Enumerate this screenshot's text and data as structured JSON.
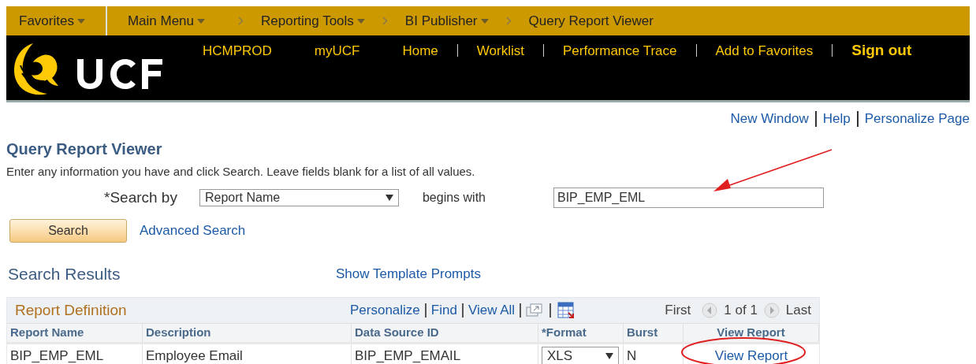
{
  "breadcrumb": [
    {
      "label": "Favorites",
      "dropdown": true
    },
    {
      "label": "Main Menu",
      "dropdown": true
    },
    {
      "label": "Reporting Tools",
      "dropdown": true
    },
    {
      "label": "BI Publisher",
      "dropdown": true
    },
    {
      "label": "Query Report Viewer",
      "dropdown": false
    }
  ],
  "header_links": [
    {
      "label": "HCMPROD",
      "emphasized": false
    },
    {
      "label": "myUCF",
      "emphasized": false
    },
    {
      "label": "Home",
      "emphasized": false
    },
    {
      "label": "Worklist",
      "emphasized": false
    },
    {
      "label": "Performance Trace",
      "emphasized": false
    },
    {
      "label": "Add to Favorites",
      "emphasized": false
    },
    {
      "label": "Sign out",
      "emphasized": true
    }
  ],
  "page_links": [
    "New Window",
    "Help",
    "Personalize Page"
  ],
  "title": "Query Report Viewer",
  "instructions": "Enter any information you have and click Search. Leave fields blank for a list of all values.",
  "search": {
    "label": "*Search by",
    "field": "Report Name",
    "operator": "begins with",
    "value": "BIP_EMP_EML",
    "button": "Search",
    "advanced_link": "Advanced Search"
  },
  "results": {
    "heading": "Search Results",
    "prompts_link": "Show Template Prompts",
    "grid": {
      "title": "Report Definition",
      "links": [
        "Personalize",
        "Find",
        "View All"
      ],
      "first": "First",
      "count": "1 of 1",
      "last": "Last",
      "columns": [
        "Report Name",
        "Description",
        "Data Source ID",
        "*Format",
        "Burst",
        "View Report"
      ],
      "rows": [
        {
          "report_name": "BIP_EMP_EML",
          "description": "Employee Email",
          "data_source_id": "BIP_EMP_EMAIL",
          "format": "XLS",
          "burst": "N",
          "view_report": "View Report"
        }
      ]
    }
  }
}
